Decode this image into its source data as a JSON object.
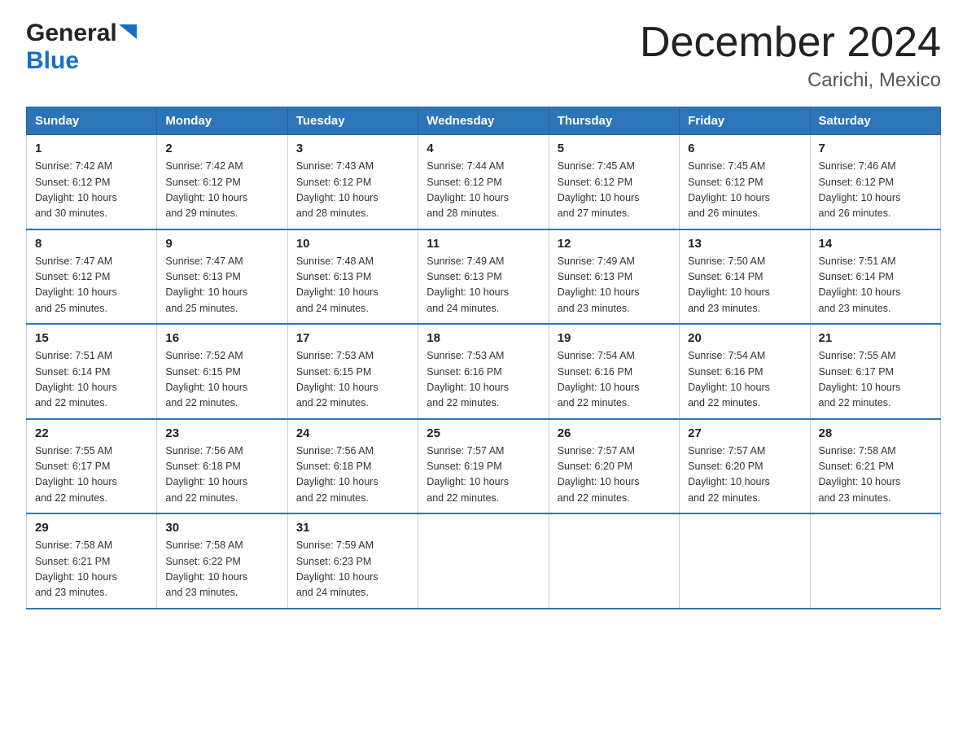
{
  "logo": {
    "general": "General",
    "blue": "Blue",
    "triangle": "▶"
  },
  "title": "December 2024",
  "subtitle": "Carichi, Mexico",
  "weekdays": [
    "Sunday",
    "Monday",
    "Tuesday",
    "Wednesday",
    "Thursday",
    "Friday",
    "Saturday"
  ],
  "weeks": [
    [
      {
        "day": "1",
        "sunrise": "7:42 AM",
        "sunset": "6:12 PM",
        "daylight": "10 hours and 30 minutes."
      },
      {
        "day": "2",
        "sunrise": "7:42 AM",
        "sunset": "6:12 PM",
        "daylight": "10 hours and 29 minutes."
      },
      {
        "day": "3",
        "sunrise": "7:43 AM",
        "sunset": "6:12 PM",
        "daylight": "10 hours and 28 minutes."
      },
      {
        "day": "4",
        "sunrise": "7:44 AM",
        "sunset": "6:12 PM",
        "daylight": "10 hours and 28 minutes."
      },
      {
        "day": "5",
        "sunrise": "7:45 AM",
        "sunset": "6:12 PM",
        "daylight": "10 hours and 27 minutes."
      },
      {
        "day": "6",
        "sunrise": "7:45 AM",
        "sunset": "6:12 PM",
        "daylight": "10 hours and 26 minutes."
      },
      {
        "day": "7",
        "sunrise": "7:46 AM",
        "sunset": "6:12 PM",
        "daylight": "10 hours and 26 minutes."
      }
    ],
    [
      {
        "day": "8",
        "sunrise": "7:47 AM",
        "sunset": "6:12 PM",
        "daylight": "10 hours and 25 minutes."
      },
      {
        "day": "9",
        "sunrise": "7:47 AM",
        "sunset": "6:13 PM",
        "daylight": "10 hours and 25 minutes."
      },
      {
        "day": "10",
        "sunrise": "7:48 AM",
        "sunset": "6:13 PM",
        "daylight": "10 hours and 24 minutes."
      },
      {
        "day": "11",
        "sunrise": "7:49 AM",
        "sunset": "6:13 PM",
        "daylight": "10 hours and 24 minutes."
      },
      {
        "day": "12",
        "sunrise": "7:49 AM",
        "sunset": "6:13 PM",
        "daylight": "10 hours and 23 minutes."
      },
      {
        "day": "13",
        "sunrise": "7:50 AM",
        "sunset": "6:14 PM",
        "daylight": "10 hours and 23 minutes."
      },
      {
        "day": "14",
        "sunrise": "7:51 AM",
        "sunset": "6:14 PM",
        "daylight": "10 hours and 23 minutes."
      }
    ],
    [
      {
        "day": "15",
        "sunrise": "7:51 AM",
        "sunset": "6:14 PM",
        "daylight": "10 hours and 22 minutes."
      },
      {
        "day": "16",
        "sunrise": "7:52 AM",
        "sunset": "6:15 PM",
        "daylight": "10 hours and 22 minutes."
      },
      {
        "day": "17",
        "sunrise": "7:53 AM",
        "sunset": "6:15 PM",
        "daylight": "10 hours and 22 minutes."
      },
      {
        "day": "18",
        "sunrise": "7:53 AM",
        "sunset": "6:16 PM",
        "daylight": "10 hours and 22 minutes."
      },
      {
        "day": "19",
        "sunrise": "7:54 AM",
        "sunset": "6:16 PM",
        "daylight": "10 hours and 22 minutes."
      },
      {
        "day": "20",
        "sunrise": "7:54 AM",
        "sunset": "6:16 PM",
        "daylight": "10 hours and 22 minutes."
      },
      {
        "day": "21",
        "sunrise": "7:55 AM",
        "sunset": "6:17 PM",
        "daylight": "10 hours and 22 minutes."
      }
    ],
    [
      {
        "day": "22",
        "sunrise": "7:55 AM",
        "sunset": "6:17 PM",
        "daylight": "10 hours and 22 minutes."
      },
      {
        "day": "23",
        "sunrise": "7:56 AM",
        "sunset": "6:18 PM",
        "daylight": "10 hours and 22 minutes."
      },
      {
        "day": "24",
        "sunrise": "7:56 AM",
        "sunset": "6:18 PM",
        "daylight": "10 hours and 22 minutes."
      },
      {
        "day": "25",
        "sunrise": "7:57 AM",
        "sunset": "6:19 PM",
        "daylight": "10 hours and 22 minutes."
      },
      {
        "day": "26",
        "sunrise": "7:57 AM",
        "sunset": "6:20 PM",
        "daylight": "10 hours and 22 minutes."
      },
      {
        "day": "27",
        "sunrise": "7:57 AM",
        "sunset": "6:20 PM",
        "daylight": "10 hours and 22 minutes."
      },
      {
        "day": "28",
        "sunrise": "7:58 AM",
        "sunset": "6:21 PM",
        "daylight": "10 hours and 23 minutes."
      }
    ],
    [
      {
        "day": "29",
        "sunrise": "7:58 AM",
        "sunset": "6:21 PM",
        "daylight": "10 hours and 23 minutes."
      },
      {
        "day": "30",
        "sunrise": "7:58 AM",
        "sunset": "6:22 PM",
        "daylight": "10 hours and 23 minutes."
      },
      {
        "day": "31",
        "sunrise": "7:59 AM",
        "sunset": "6:23 PM",
        "daylight": "10 hours and 24 minutes."
      },
      null,
      null,
      null,
      null
    ]
  ],
  "labels": {
    "sunrise": "Sunrise:",
    "sunset": "Sunset:",
    "daylight": "Daylight:"
  }
}
